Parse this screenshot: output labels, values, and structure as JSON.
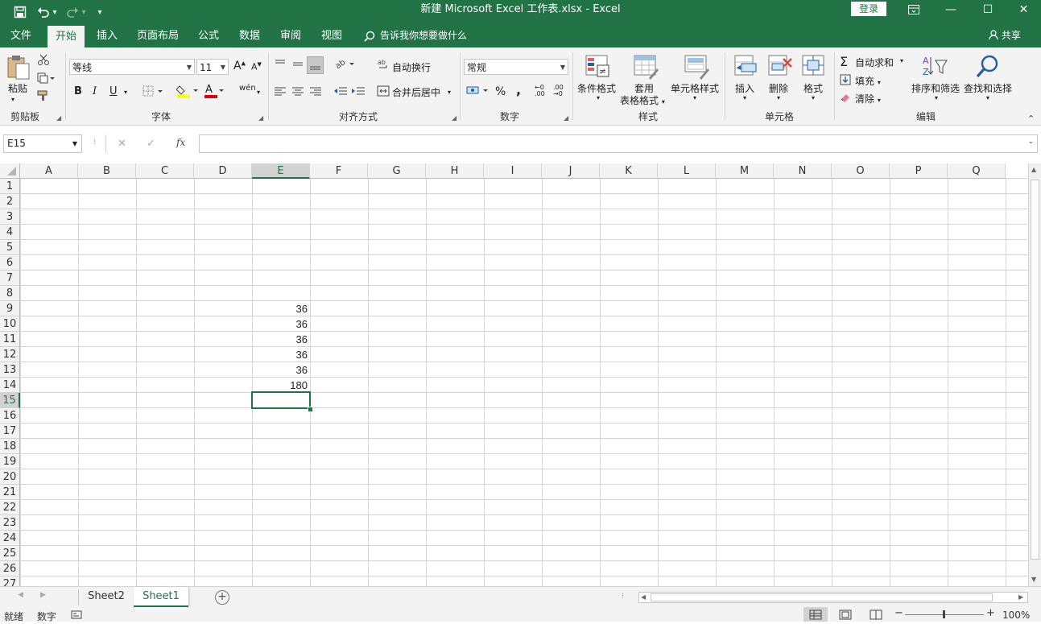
{
  "window": {
    "title": "新建 Microsoft Excel 工作表.xlsx  -  Excel",
    "login_label": "登录",
    "minimize": "—",
    "restore": "☐",
    "close": "✕",
    "ribbon_display": "▭"
  },
  "qat": {
    "undo_dropdown": "▾",
    "customize": "▾"
  },
  "tabs": [
    {
      "label": "文件",
      "active": false
    },
    {
      "label": "开始",
      "active": true
    },
    {
      "label": "插入",
      "active": false
    },
    {
      "label": "页面布局",
      "active": false
    },
    {
      "label": "公式",
      "active": false
    },
    {
      "label": "数据",
      "active": false
    },
    {
      "label": "审阅",
      "active": false
    },
    {
      "label": "视图",
      "active": false
    }
  ],
  "tell_me": "告诉我你想要做什么",
  "share": "共享",
  "ribbon": {
    "clipboard": {
      "label": "剪贴板",
      "paste": "粘贴"
    },
    "font": {
      "label": "字体",
      "font_name": "等线",
      "font_size": "11",
      "bold": "B",
      "italic": "I",
      "underline": "U",
      "grow": "A",
      "shrink": "A",
      "phonetic": "wén"
    },
    "alignment": {
      "label": "对齐方式",
      "wrap": "自动换行",
      "merge": "合并后居中"
    },
    "number": {
      "label": "数字",
      "format": "常规",
      "percent": "%",
      "comma": ",",
      "inc_decimal": "←0 .00",
      "dec_decimal": ".00 →0"
    },
    "styles": {
      "label": "样式",
      "conditional": "条件格式",
      "table_format_1": "套用",
      "table_format_2": "表格格式",
      "cell_styles": "单元格样式"
    },
    "cells": {
      "label": "单元格",
      "insert": "插入",
      "delete": "删除",
      "format": "格式"
    },
    "editing": {
      "label": "编辑",
      "autosum": "自动求和",
      "fill": "填充",
      "clear": "清除",
      "sort": "排序和筛选",
      "find": "查找和选择"
    }
  },
  "formula_bar": {
    "name_box": "E15",
    "fx": "fx",
    "formula": "",
    "cancel": "✕",
    "enter": "✓"
  },
  "columns": [
    "A",
    "B",
    "C",
    "D",
    "E",
    "F",
    "G",
    "H",
    "I",
    "J",
    "K",
    "L",
    "M",
    "N",
    "O",
    "P",
    "Q"
  ],
  "rows": [
    "1",
    "2",
    "3",
    "4",
    "5",
    "6",
    "7",
    "8",
    "9",
    "10",
    "11",
    "12",
    "13",
    "14",
    "15",
    "16",
    "17",
    "18",
    "19",
    "20",
    "21",
    "22",
    "23",
    "24",
    "25",
    "26",
    "27"
  ],
  "cells": [
    {
      "ref": "E9",
      "value": "36"
    },
    {
      "ref": "E10",
      "value": "36"
    },
    {
      "ref": "E11",
      "value": "36"
    },
    {
      "ref": "E12",
      "value": "36"
    },
    {
      "ref": "E13",
      "value": "36"
    },
    {
      "ref": "E14",
      "value": "180"
    }
  ],
  "selected_cell": "E15",
  "sheets": [
    {
      "name": "Sheet2",
      "active": false
    },
    {
      "name": "Sheet1",
      "active": true
    }
  ],
  "add_sheet": "+",
  "status": {
    "ready": "就绪",
    "mode": "数字",
    "zoom": "100%",
    "zoom_minus": "−",
    "zoom_plus": "+"
  },
  "colors": {
    "accent": "#217346",
    "ribbon_bg": "#f3f3f3",
    "grid_line": "#d4d4d4"
  }
}
